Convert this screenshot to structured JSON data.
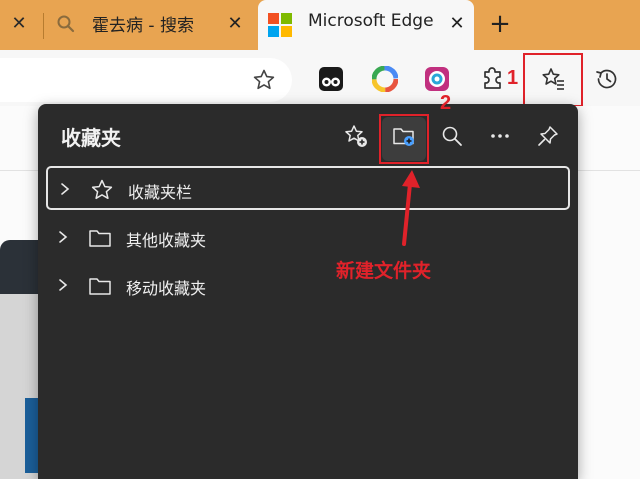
{
  "tabs": [
    {
      "title": "",
      "close": "✕"
    },
    {
      "title": "霍去病 - 搜索",
      "close": "✕"
    },
    {
      "title": "Microsoft Edge",
      "close": "✕"
    }
  ],
  "new_tab": "+",
  "favorites_panel": {
    "title": "收藏夹",
    "items": [
      {
        "label": "收藏夹栏",
        "icon": "star-icon"
      },
      {
        "label": "其他收藏夹",
        "icon": "folder-icon"
      },
      {
        "label": "移动收藏夹",
        "icon": "folder-icon"
      }
    ]
  },
  "annotations": {
    "marker1": "1",
    "marker2": "2",
    "callout": "新建文件夹",
    "color": "#e0222a"
  }
}
